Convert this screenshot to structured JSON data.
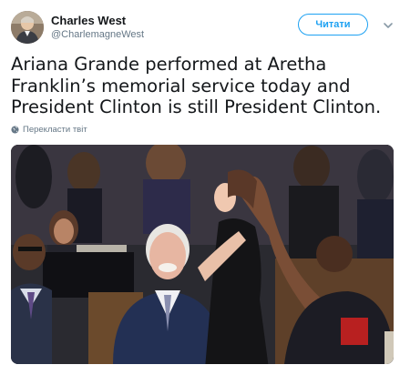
{
  "tweet": {
    "author_name": "Charles West",
    "author_handle": "@CharlemagneWest",
    "follow_label": "Читати",
    "text": "Ariana Grande performed at Aretha Franklin’s memorial service today and President Clinton is still President Clinton.",
    "translate_label": "Перекласти твіт"
  },
  "icons": {
    "caret": "chevron-down-icon",
    "translate": "globe-icon",
    "avatar": "user-avatar"
  },
  "colors": {
    "accent": "#1da1f2",
    "text": "#14171a",
    "secondary": "#657786"
  }
}
